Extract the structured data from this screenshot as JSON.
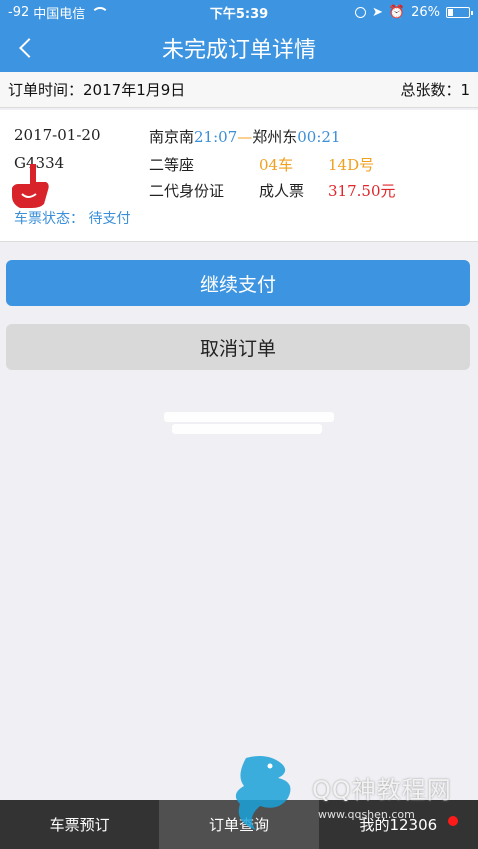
{
  "status_bar": {
    "signal": "-92",
    "carrier": "中国电信",
    "time": "下午5:39",
    "battery": "26%",
    "battery_level": 0.26
  },
  "nav": {
    "title": "未完成订单详情",
    "back_icon": "chevron-left-icon"
  },
  "summary": {
    "order_time_label": "订单时间：",
    "order_time": "2017年1月9日",
    "total_label": "总张数：",
    "total": "1"
  },
  "ticket": {
    "date": "2017-01-20",
    "from_station": "南京南",
    "depart_time": "21:07",
    "dash": "—",
    "to_station": "郑州东",
    "arrive_time": "00:21",
    "train_no": "G4334",
    "seat_class": "二等座",
    "car": "04车",
    "seat": "14D号",
    "id_type": "二代身份证",
    "ticket_type": "成人票",
    "price": "317.50元",
    "status_label": "车票状态：",
    "status_value": "待支付"
  },
  "buttons": {
    "continue_pay": "继续支付",
    "cancel_order": "取消订单"
  },
  "tabs": [
    {
      "label": "车票预订",
      "active": false
    },
    {
      "label": "订单查询",
      "active": true
    },
    {
      "label": "我的12306",
      "active": false,
      "badge": true
    }
  ],
  "watermark": {
    "title": "QQ神教程网",
    "url": "www.qqshen.com"
  },
  "colors": {
    "primary": "#3d94e0",
    "link": "#3a8fd8",
    "orange": "#f0a020",
    "price": "#e0262b",
    "tabbar": "#333333",
    "badge": "#ff1a1a"
  }
}
